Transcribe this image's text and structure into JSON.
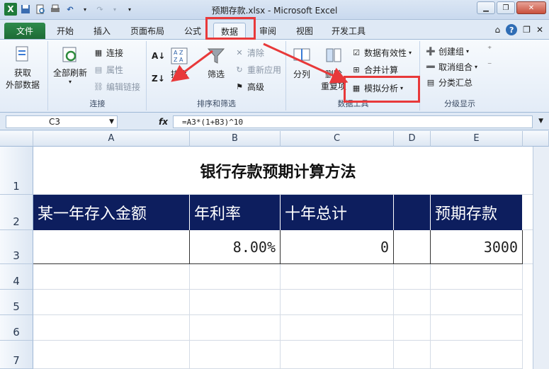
{
  "titlebar": {
    "title": "预期存款.xlsx - Microsoft Excel",
    "logo": "X"
  },
  "tabs": [
    "文件",
    "开始",
    "插入",
    "页面布局",
    "公式",
    "数据",
    "审阅",
    "视图",
    "开发工具"
  ],
  "ribbon": {
    "get_external": [
      "获取",
      "外部数据"
    ],
    "refresh_all": "全部刷新",
    "connections": "连接",
    "properties": "属性",
    "edit_links": "编辑链接",
    "group_connections": "连接",
    "sort": "排序",
    "filter": "筛选",
    "clear": "清除",
    "reapply": "重新应用",
    "advanced": "高级",
    "group_sortfilter": "排序和筛选",
    "split": "分列",
    "remove_dup_1": "删除",
    "remove_dup_2": "重复项",
    "data_validation": "数据有效性",
    "consolidate": "合并计算",
    "whatif": "模拟分析",
    "group_datatools": "数据工具",
    "group_create": "创建组",
    "ungroup": "取消组合",
    "subtotal": "分类汇总",
    "group_outline": "分级显示"
  },
  "formula_bar": {
    "name_box": "C3",
    "fx": "fx",
    "formula": "=A3*(1+B3)^10"
  },
  "sheet": {
    "columns": [
      "A",
      "B",
      "C",
      "D",
      "E"
    ],
    "rows": [
      "1",
      "2",
      "3",
      "4",
      "5",
      "6",
      "7"
    ],
    "title": "银行存款预期计算方法",
    "headers": [
      "某一年存入金额",
      "年利率",
      "十年总计",
      "",
      "预期存款"
    ],
    "values": [
      "",
      "8.00%",
      "0",
      "",
      "3000"
    ]
  },
  "colors": {
    "header_fill": "#0d1e5e",
    "highlight": "#e8393a",
    "file_tab": "#1d6b36"
  }
}
